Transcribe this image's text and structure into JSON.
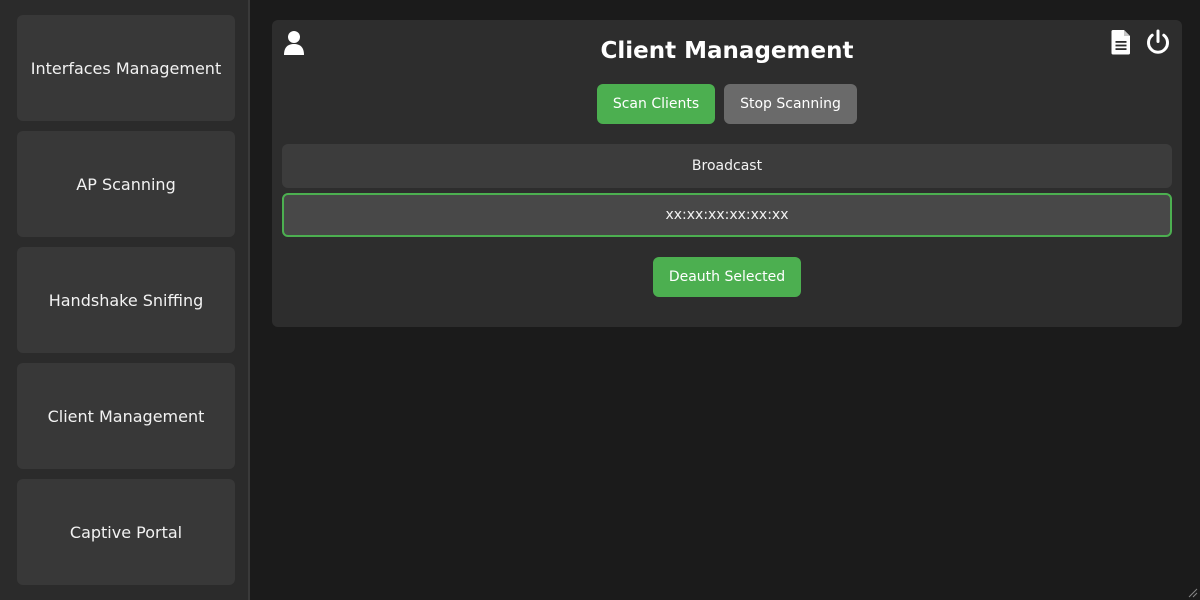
{
  "sidebar": {
    "items": [
      {
        "label": "Interfaces Management"
      },
      {
        "label": "AP Scanning"
      },
      {
        "label": "Handshake Sniffing"
      },
      {
        "label": "Client Management"
      },
      {
        "label": "Captive Portal"
      }
    ]
  },
  "header": {
    "title": "Client Management",
    "icons": {
      "user": "user-icon",
      "document": "document-icon",
      "power": "power-icon"
    }
  },
  "actions": {
    "scan_label": "Scan Clients",
    "stop_label": "Stop Scanning",
    "deauth_label": "Deauth Selected"
  },
  "clients": [
    {
      "label": "Broadcast",
      "selected": false
    },
    {
      "label": "xx:xx:xx:xx:xx:xx",
      "selected": true
    }
  ],
  "colors": {
    "accent": "#4caf50",
    "background": "#1b1b1b",
    "sidebar": "#2b2b2b",
    "panel": "#2d2d2d",
    "secondary_button": "#6a6a6a"
  }
}
